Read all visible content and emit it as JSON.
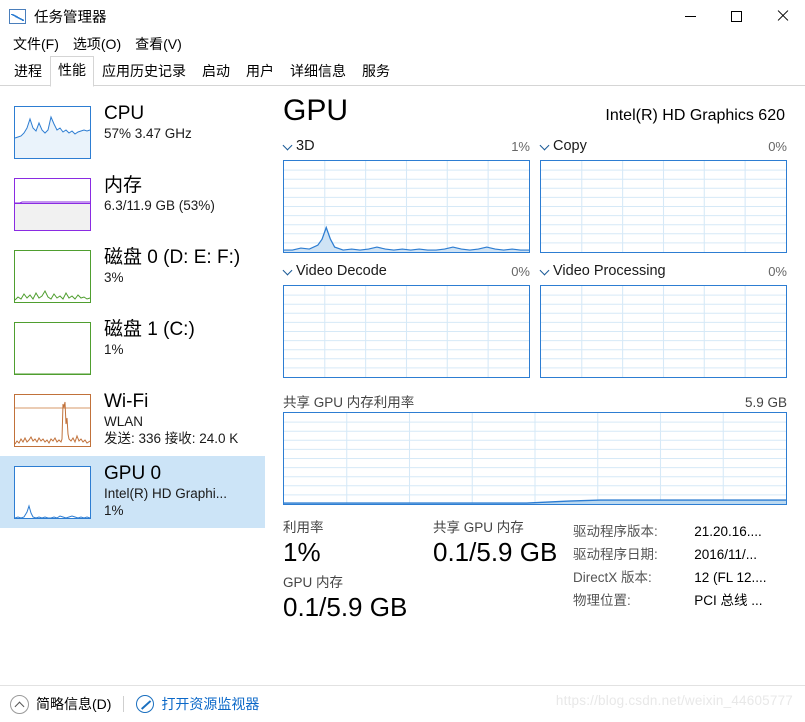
{
  "window": {
    "title": "任务管理器",
    "icon": "task-manager-icon",
    "minimize_label": "最小化",
    "maximize_label": "最大化",
    "close_label": "关闭"
  },
  "menu": {
    "items": [
      {
        "label": "文件(F)"
      },
      {
        "label": "选项(O)"
      },
      {
        "label": "查看(V)"
      }
    ]
  },
  "tabs": {
    "items": [
      {
        "label": "进程",
        "active": false
      },
      {
        "label": "性能",
        "active": true
      },
      {
        "label": "应用历史记录",
        "active": false
      },
      {
        "label": "启动",
        "active": false
      },
      {
        "label": "用户",
        "active": false
      },
      {
        "label": "详细信息",
        "active": false
      },
      {
        "label": "服务",
        "active": false
      }
    ]
  },
  "sidebar": {
    "items": [
      {
        "title": "CPU",
        "sub1": "57% 3.47 GHz",
        "sub2": "",
        "sub3": "",
        "color": "#2d7dd2",
        "selected": false
      },
      {
        "title": "内存",
        "sub1": "6.3/11.9 GB (53%)",
        "sub2": "",
        "sub3": "",
        "color": "#8a2be2",
        "selected": false
      },
      {
        "title": "磁盘 0 (D: E: F:)",
        "sub1": "3%",
        "sub2": "",
        "sub3": "",
        "color": "#4f9e2f",
        "selected": false
      },
      {
        "title": "磁盘 1 (C:)",
        "sub1": "1%",
        "sub2": "",
        "sub3": "",
        "color": "#4f9e2f",
        "selected": false
      },
      {
        "title": "Wi-Fi",
        "sub1": "WLAN",
        "sub2": "发送: 336 接收: 24.0 K",
        "sub3": "",
        "color": "#c1713a",
        "selected": false
      },
      {
        "title": "GPU 0",
        "sub1": "Intel(R) HD Graphi...",
        "sub2": "1%",
        "sub3": "",
        "color": "#2d7dd2",
        "selected": true
      }
    ]
  },
  "main": {
    "title": "GPU",
    "device": "Intel(R) HD Graphics 620",
    "charts": [
      {
        "label": "3D",
        "value": "1%"
      },
      {
        "label": "Copy",
        "value": "0%"
      },
      {
        "label": "Video Decode",
        "value": "0%"
      },
      {
        "label": "Video Processing",
        "value": "0%"
      }
    ],
    "shared_chart": {
      "label": "共享 GPU 内存利用率",
      "max": "5.9 GB"
    },
    "stats": [
      {
        "key": "利用率",
        "value": "1%"
      },
      {
        "key": "共享 GPU 内存",
        "value": "0.1/5.9 GB"
      },
      {
        "key": "GPU 内存",
        "value": "0.1/5.9 GB"
      }
    ],
    "info": [
      {
        "key": "驱动程序版本:",
        "value": "21.20.16...."
      },
      {
        "key": "驱动程序日期:",
        "value": "2016/11/..."
      },
      {
        "key": "DirectX 版本:",
        "value": "12 (FL 12...."
      },
      {
        "key": "物理位置:",
        "value": "PCI 总线 ..."
      }
    ]
  },
  "statusbar": {
    "brief_label": "简略信息(D)",
    "resmon_label": "打开资源监视器"
  },
  "watermark": "https://blog.csdn.net/weixin_44605777",
  "chart_data": {
    "type": "line",
    "title": "GPU engine utilization over 60 seconds",
    "charts": [
      {
        "name": "3D",
        "ylabel": "%",
        "ylim": [
          0,
          100
        ],
        "current": 1,
        "grid": true,
        "values": [
          1,
          1,
          2,
          1,
          1,
          2,
          3,
          4,
          3,
          2,
          6,
          14,
          9,
          4,
          2,
          1,
          1,
          1,
          1,
          2,
          1,
          1,
          1,
          2,
          3,
          2,
          1,
          1,
          1,
          1,
          1,
          2,
          2,
          1,
          1,
          1,
          1,
          2,
          3,
          3,
          2,
          1,
          1,
          1,
          1,
          2,
          4,
          3,
          2,
          1,
          1,
          1,
          2,
          3,
          4,
          3,
          2,
          1,
          1,
          1
        ]
      },
      {
        "name": "Copy",
        "ylabel": "%",
        "ylim": [
          0,
          100
        ],
        "current": 0,
        "grid": true,
        "values": [
          0,
          0,
          0,
          0,
          0,
          0,
          0,
          0,
          0,
          0,
          0,
          0,
          0,
          0,
          0,
          0,
          0,
          0,
          0,
          0,
          0,
          0,
          0,
          0,
          0,
          0,
          0,
          0,
          0,
          0,
          0,
          0,
          0,
          0,
          0,
          0,
          0,
          0,
          0,
          0,
          0,
          0,
          0,
          0,
          0,
          0,
          0,
          0,
          0,
          0,
          0,
          0,
          0,
          0,
          0,
          0,
          0,
          0,
          0,
          0
        ]
      },
      {
        "name": "Video Decode",
        "ylabel": "%",
        "ylim": [
          0,
          100
        ],
        "current": 0,
        "grid": true,
        "values": [
          0,
          0,
          0,
          0,
          0,
          0,
          0,
          0,
          0,
          0,
          0,
          0,
          0,
          0,
          0,
          0,
          0,
          0,
          0,
          0,
          0,
          0,
          0,
          0,
          0,
          0,
          0,
          0,
          0,
          0,
          0,
          0,
          0,
          0,
          0,
          0,
          0,
          0,
          0,
          0,
          0,
          0,
          0,
          0,
          0,
          0,
          0,
          0,
          0,
          0,
          0,
          0,
          0,
          0,
          0,
          0,
          0,
          0,
          0,
          0
        ]
      },
      {
        "name": "Video Processing",
        "ylabel": "%",
        "ylim": [
          0,
          100
        ],
        "current": 0,
        "grid": true,
        "values": [
          0,
          0,
          0,
          0,
          0,
          0,
          0,
          0,
          0,
          0,
          0,
          0,
          0,
          0,
          0,
          0,
          0,
          0,
          0,
          0,
          0,
          0,
          0,
          0,
          0,
          0,
          0,
          0,
          0,
          0,
          0,
          0,
          0,
          0,
          0,
          0,
          0,
          0,
          0,
          0,
          0,
          0,
          0,
          0,
          0,
          0,
          0,
          0,
          0,
          0,
          0,
          0,
          0,
          0,
          0,
          0,
          0,
          0,
          0,
          0
        ]
      },
      {
        "name": "共享 GPU 内存利用率",
        "ylabel": "GB",
        "ylim": [
          0,
          5.9
        ],
        "current": 0.1,
        "grid": true,
        "values": [
          0.05,
          0.05,
          0.05,
          0.05,
          0.05,
          0.05,
          0.05,
          0.05,
          0.05,
          0.05,
          0.05,
          0.05,
          0.05,
          0.05,
          0.05,
          0.05,
          0.05,
          0.05,
          0.05,
          0.05,
          0.05,
          0.05,
          0.05,
          0.05,
          0.05,
          0.05,
          0.05,
          0.06,
          0.07,
          0.08,
          0.1,
          0.1,
          0.1,
          0.1,
          0.1,
          0.1,
          0.1,
          0.1,
          0.1,
          0.1,
          0.1,
          0.1,
          0.1,
          0.1,
          0.1,
          0.1,
          0.1,
          0.1,
          0.1,
          0.1,
          0.1,
          0.1,
          0.1,
          0.1,
          0.1,
          0.1,
          0.1,
          0.1,
          0.1,
          0.1
        ]
      }
    ],
    "sidebar_sparklines": [
      {
        "name": "CPU",
        "color": "#2d7dd2",
        "current": 57
      },
      {
        "name": "内存",
        "color": "#8a2be2",
        "current": 53
      },
      {
        "name": "磁盘 0",
        "color": "#4f9e2f",
        "current": 3
      },
      {
        "name": "磁盘 1",
        "color": "#4f9e2f",
        "current": 1
      },
      {
        "name": "Wi-Fi",
        "color": "#c1713a",
        "current": 0
      },
      {
        "name": "GPU 0",
        "color": "#2d7dd2",
        "current": 1
      }
    ]
  }
}
